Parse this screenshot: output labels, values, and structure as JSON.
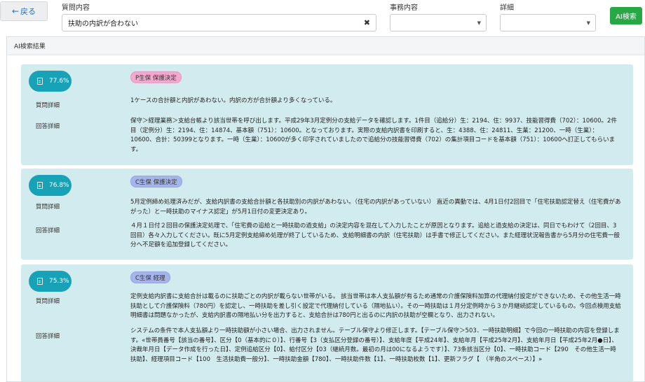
{
  "toolbar": {
    "back_label": "戻る",
    "question_label": "質問内容",
    "question_value": "扶助の内訳が合わない",
    "clear_icon": "✖",
    "business_label": "事務内容",
    "business_value": "",
    "detail_label": "詳細",
    "detail_value": "",
    "ai_search_label": "AI検索"
  },
  "results": {
    "header": "AI検索結果",
    "question_detail_label": "質問詳細",
    "answer_detail_label": "回答詳細",
    "items": [
      {
        "score": "77.6%",
        "tag": "P生保 保護決定",
        "question": "1ケースの合計額と内訳があわない。内訳の方が合計額より多くなっている。",
        "answer": "保守＞経理業務＞支給台帳より該当世帯を呼び出します。平成29年3月定例分の支給データを確認します。1件目（追給分）生：2194、住：9937、技能習得費（702）：10600。2件目（定例分）生：2194、住：14874、基本額（751）：10600。となっております。実際の支給内訳書を印刷すると、生：4388、住：24811、生業：21200、一時（生業）：10600、合計：50399となります。一時（生業）：10600が多く印字されていましたので追給分の技能習得費（702）の集計項目コードを基本額（751）：10600へ訂正してもらいます。"
      },
      {
        "score": "76.8%",
        "tag": "C生保 保護決定",
        "question": "5月定例締め処理済みだが、支給内訳書の支給合計額と各扶助別の内訳があわない。（住宅の内訳があっていない） 直近の異動では、4月1日付2回目で「住宅扶助認定替え（住宅費があがった）と一時扶助のマイナス認定」が5月1日付の変更決定あり。",
        "answer": "４月１日付２回目の保護決定処理で、「住宅費の追給と一時扶助の過支給」の決定内容を混在して入力したことが原因となります。追給と過支給の決定は、同日でもわけて（2回目、3回目）各々入力してください。既に5月定例支給締め処理が終了しているため、支給明細書の内訳（住宅扶助）は手書で修正してください。また経理状況報告書から5月分の住宅費一般分へ不足額を追加登録してください。"
      },
      {
        "score": "75.3%",
        "tag": "C生保 経理",
        "question": "定例支給内訳書に支給合計は載るのに扶助ごとの内訳が載らない世帯がいる。 該当世帯は本人支払額が有るため通常の介護保険料加算の代理納付設定ができないため、その他生活一時扶助として介護保険料（780円）を認定し、一時扶助を差し引く設定で代理納付している（隔地払い）。その一時扶助は１月分定例時から３か月継続認定しているもの。今回点検用支給明細書は問題なかったが、支給内訳書の隔地払い分を出力すると、支給合計は780円と出るのに内訳の扶助が空欄となり、出力されない。",
        "answer": "システムの条件で本人支払額より一時扶助額が小さい場合、出力されません。テーブル保守より修正します。【テーブル保守＞503．一時扶助明細】で今回の一時扶助の内容を登録します。«世帯員番号【該当の番号】、区分【0（基本的に０）】、行番号【3（支払区分登録の番号）】、支給年度【平成24年】、支給年月【平成25年2月】、支給年月日【平成25年2月●日】、決裁年月日【データ作成を行った日】、定例追給区分【0】、給付区分【03（継続月数。最初の月は00になるようです）】、73条該当区分【0】、一時扶助コード【290　その他生活一時扶助】、経理項目コード【100　生活扶助費一般分】、一時扶助金額【780】、一時扶助件数【1】、一時扶助枚数【1】、更新フラグ【　（半角のスペース）】»"
      }
    ]
  }
}
